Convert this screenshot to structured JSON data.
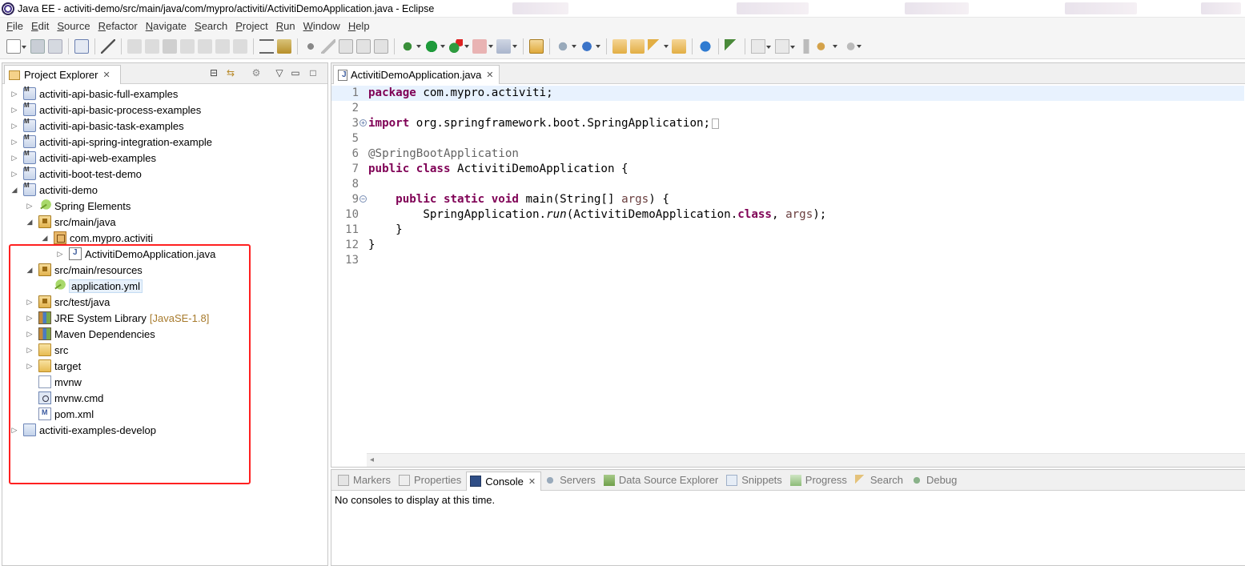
{
  "window": {
    "title": "Java EE - activiti-demo/src/main/java/com/mypro/activiti/ActivitiDemoApplication.java - Eclipse"
  },
  "menu": [
    "File",
    "Edit",
    "Source",
    "Refactor",
    "Navigate",
    "Search",
    "Project",
    "Run",
    "Window",
    "Help"
  ],
  "project_explorer": {
    "tab_label": "Project Explorer",
    "items": [
      {
        "label": "activiti-api-basic-full-examples"
      },
      {
        "label": "activiti-api-basic-process-examples"
      },
      {
        "label": "activiti-api-basic-task-examples"
      },
      {
        "label": "activiti-api-spring-integration-example"
      },
      {
        "label": "activiti-api-web-examples"
      },
      {
        "label": "activiti-boot-test-demo"
      },
      {
        "label": "activiti-demo"
      },
      {
        "label": "Spring Elements"
      },
      {
        "label": "src/main/java"
      },
      {
        "label": "com.mypro.activiti"
      },
      {
        "label": "ActivitiDemoApplication.java"
      },
      {
        "label": "src/main/resources"
      },
      {
        "label": "application.yml"
      },
      {
        "label": "src/test/java"
      },
      {
        "label": "JRE System Library",
        "decoration": "[JavaSE-1.8]"
      },
      {
        "label": "Maven Dependencies"
      },
      {
        "label": "src"
      },
      {
        "label": "target"
      },
      {
        "label": "mvnw"
      },
      {
        "label": "mvnw.cmd"
      },
      {
        "label": "pom.xml"
      },
      {
        "label": "activiti-examples-develop"
      }
    ]
  },
  "editor": {
    "tab_label": "ActivitiDemoApplication.java",
    "line_numbers": [
      "1",
      "2",
      "3",
      "5",
      "6",
      "7",
      "8",
      "9",
      "10",
      "11",
      "12",
      "13"
    ],
    "code": {
      "l1_kw": "package",
      "l1_rest": " com.mypro.activiti;",
      "l3_kw": "import",
      "l3_rest": " org.springframework.boot.SpringApplication;",
      "l6_annot": "@SpringBootApplication",
      "l7_kw1": "public",
      "l7_kw2": "class",
      "l7_rest": " ActivitiDemoApplication {",
      "l9_kw1": "public",
      "l9_kw2": "static",
      "l9_kw3": "void",
      "l9_rest1": " main(String[] ",
      "l9_param": "args",
      "l9_rest2": ") {",
      "l10_a": "SpringApplication.",
      "l10_run": "run",
      "l10_b": "(ActivitiDemoApplication.",
      "l10_kw": "class",
      "l10_c": ", ",
      "l10_param": "args",
      "l10_d": ");",
      "l11": "}",
      "l12": "}"
    }
  },
  "bottom_panel": {
    "tabs": [
      {
        "label": "Markers"
      },
      {
        "label": "Properties"
      },
      {
        "label": "Console",
        "active": true
      },
      {
        "label": "Servers"
      },
      {
        "label": "Data Source Explorer"
      },
      {
        "label": "Snippets"
      },
      {
        "label": "Progress"
      },
      {
        "label": "Search"
      },
      {
        "label": "Debug"
      }
    ],
    "console_message": "No consoles to display at this time."
  },
  "colors": {
    "keyword": "#7f0055",
    "annotation": "#646464",
    "highlight_box": "#ff2020",
    "current_line": "#e8f2fe"
  }
}
